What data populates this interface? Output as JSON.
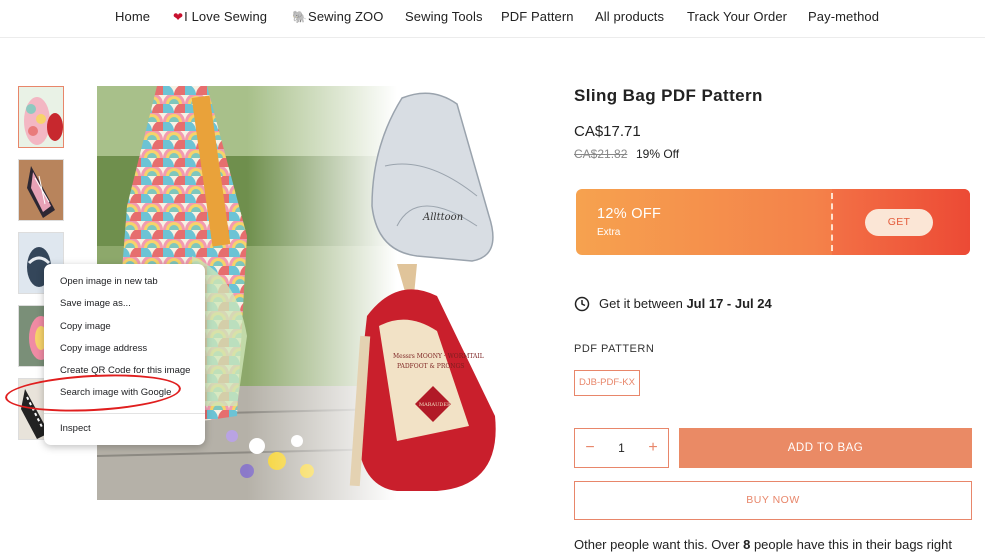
{
  "nav": {
    "items": [
      {
        "label": "Home"
      },
      {
        "label": "I Love Sewing",
        "icon": "heart-icon"
      },
      {
        "label": "Sewing ZOO",
        "icon": "elephant-icon"
      },
      {
        "label": "Sewing Tools"
      },
      {
        "label": "PDF Pattern"
      },
      {
        "label": "All products"
      },
      {
        "label": "Track Your Order"
      },
      {
        "label": "Pay-method"
      }
    ]
  },
  "gallery": {
    "thumbnail_count": 5,
    "main_image": {
      "brand_label": "Allttoon",
      "bag_text_top": "Messrs MOONY, WORMTAIL PADFOOT & PRONGS are proud to present",
      "bag_text_bottom": "The MARAUDER'S MAP"
    }
  },
  "context_menu": {
    "items": [
      "Open image in new tab",
      "Save image as...",
      "Copy image",
      "Copy image address",
      "Create QR Code for this image",
      "Search image with Google",
      "Inspect"
    ],
    "highlighted": "Search image with Google"
  },
  "product": {
    "title": "Sling Bag PDF Pattern",
    "price": "CA$17.71",
    "original_price": "CA$21.82",
    "discount": "19% Off",
    "coupon": {
      "percent": "12% OFF",
      "subtitle": "Extra",
      "button": "GET"
    },
    "delivery_prefix": "Get it between ",
    "delivery_start": "Jul 17",
    "delivery_sep": " - ",
    "delivery_end": "Jul 24",
    "variant_label": "PDF PATTERN",
    "variant_value": "DJB-PDF-KX",
    "quantity": "1",
    "quantity_minus": "−",
    "quantity_plus": "+",
    "add_to_bag": "ADD TO BAG",
    "buy_now": "BUY NOW",
    "social_prefix": "Other people want this. Over ",
    "social_count": "8",
    "social_suffix": " people have this in their bags right"
  },
  "colors": {
    "accent": "#e8866a",
    "coupon_start": "#f6a24f",
    "coupon_end": "#ec4a35",
    "highlight_circle": "#e01e1e"
  }
}
